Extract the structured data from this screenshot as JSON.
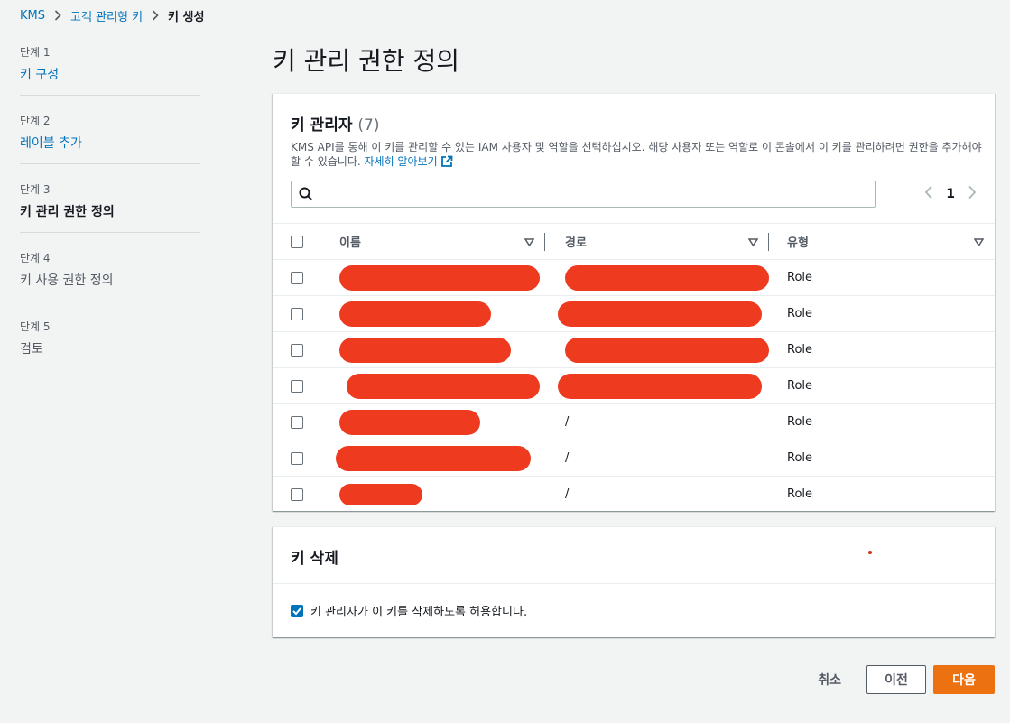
{
  "breadcrumb": {
    "items": [
      "KMS",
      "고객 관리형 키",
      "키 생성"
    ]
  },
  "steps": [
    {
      "num": "단계 1",
      "title": "키 구성",
      "state": "link"
    },
    {
      "num": "단계 2",
      "title": "레이블 추가",
      "state": "link"
    },
    {
      "num": "단계 3",
      "title": "키 관리 권한 정의",
      "state": "current"
    },
    {
      "num": "단계 4",
      "title": "키 사용 권한 정의",
      "state": "disabled"
    },
    {
      "num": "단계 5",
      "title": "검토",
      "state": "disabled"
    }
  ],
  "page_title": "키 관리 권한 정의",
  "key_admins": {
    "title": "키 관리자",
    "count": "(7)",
    "description": "KMS API를 통해 이 키를 관리할 수 있는 IAM 사용자 및 역할을 선택하십시오. 해당 사용자 또는 역할로 이 콘솔에서 이 키를 관리하려면 권한을 추가해야 할 수 있습니다.",
    "learn_more": "자세히 알아보기",
    "search_placeholder": "",
    "page": "1",
    "columns": {
      "name": "이름",
      "path": "경로",
      "type": "유형"
    },
    "rows": [
      {
        "path": "",
        "type": "Role",
        "name_redacted": true,
        "path_redacted": true
      },
      {
        "path": "",
        "type": "Role",
        "name_redacted": true,
        "path_redacted": true
      },
      {
        "path": "",
        "type": "Role",
        "name_redacted": true,
        "path_redacted": true
      },
      {
        "path": "",
        "type": "Role",
        "name_redacted": true,
        "path_redacted": true
      },
      {
        "path": "/",
        "type": "Role",
        "name_redacted": true,
        "path_redacted": false
      },
      {
        "path": "/",
        "type": "Role",
        "name_redacted": true,
        "path_redacted": false
      },
      {
        "path": "/",
        "type": "Role",
        "name_redacted": true,
        "path_redacted": false
      }
    ]
  },
  "key_deletion": {
    "title": "키 삭제",
    "allow_label": "키 관리자가 이 키를 삭제하도록 허용합니다.",
    "allow_checked": true
  },
  "actions": {
    "cancel": "취소",
    "previous": "이전",
    "next": "다음"
  },
  "colors": {
    "link": "#0073bb",
    "primary": "#ec7211",
    "redaction": "#ee3b20"
  }
}
